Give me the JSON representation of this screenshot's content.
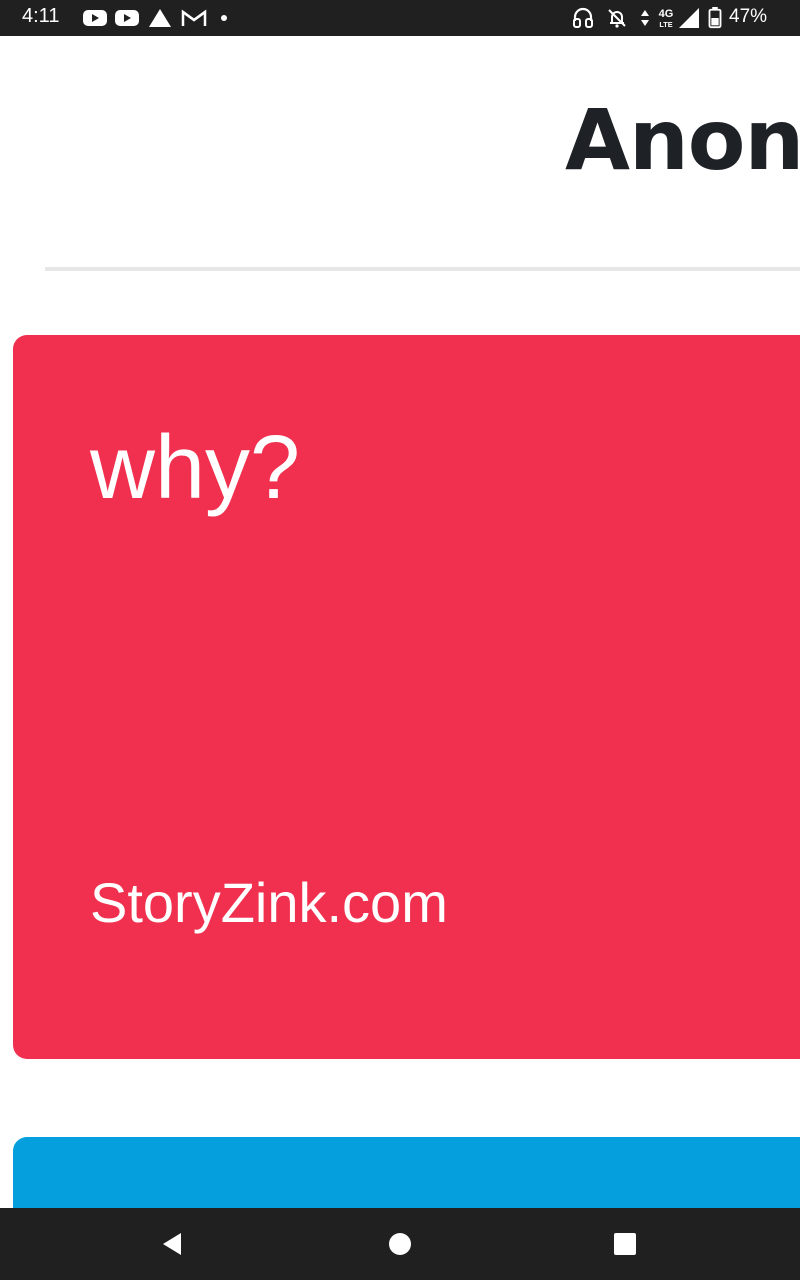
{
  "status_bar": {
    "time": "4:11",
    "battery_percent": "47%",
    "icons": [
      "youtube-icon",
      "youtube-icon",
      "drive-icon",
      "gmail-icon",
      "dot-icon",
      "headset-icon",
      "notifications-off-icon",
      "data-arrows-icon",
      "4g-lte-icon",
      "signal-icon",
      "battery-icon"
    ]
  },
  "page": {
    "title": "Anon"
  },
  "cards": [
    {
      "question": "why?",
      "site": "StoryZink.com",
      "color": "#f0304e"
    },
    {
      "color": "#049fdc"
    }
  ],
  "navbar": {
    "buttons": [
      "back-icon",
      "home-icon",
      "recents-icon"
    ]
  }
}
